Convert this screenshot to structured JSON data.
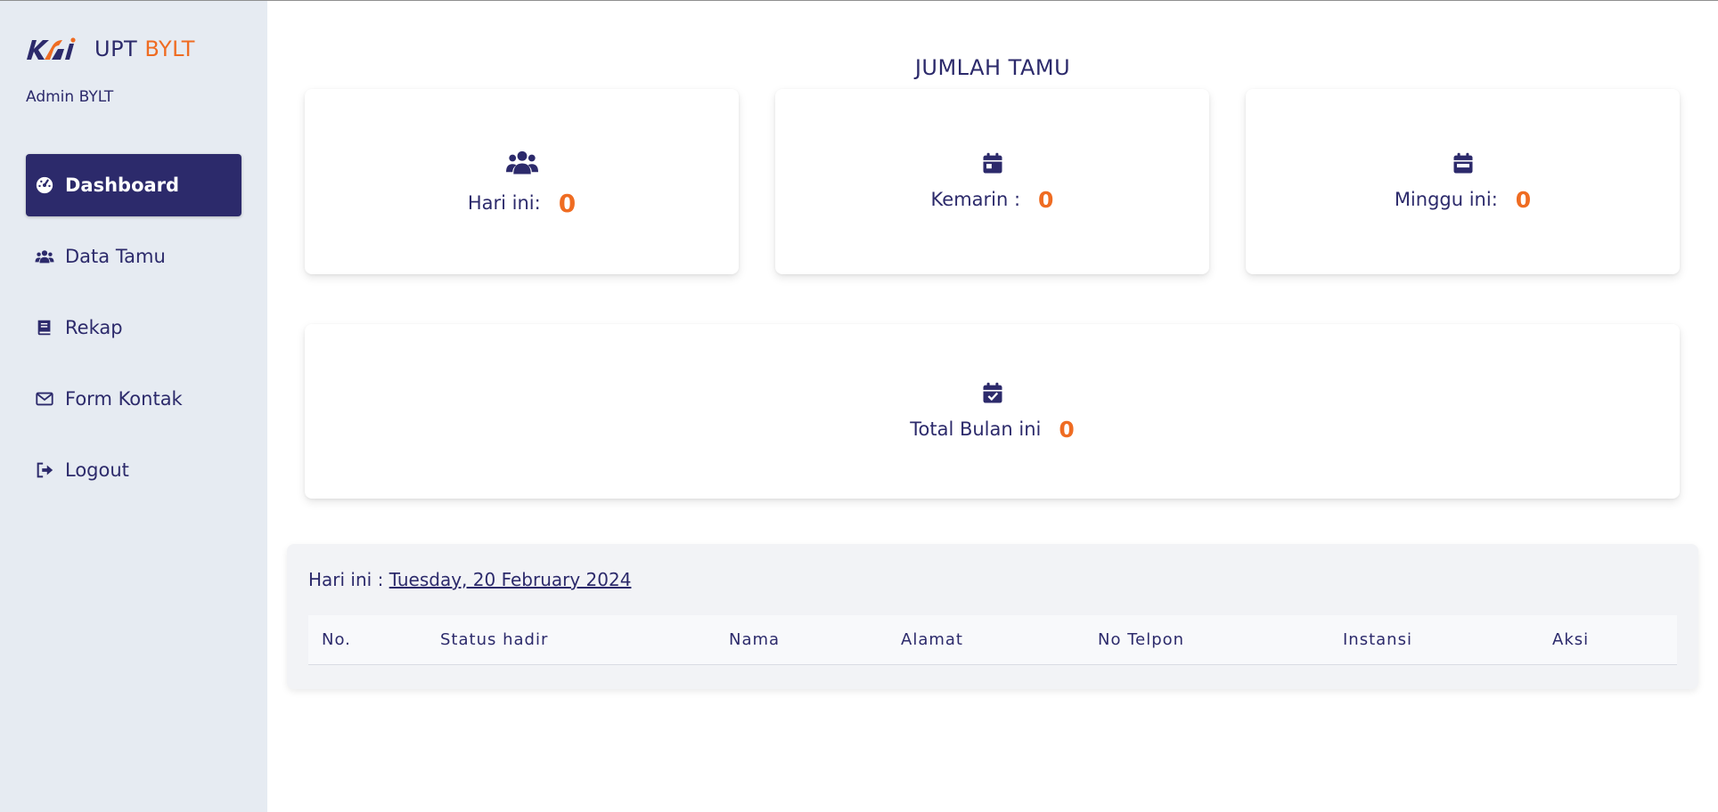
{
  "brand": {
    "logo": "kai-logo",
    "prefix": "UPT",
    "highlight": "BYLT"
  },
  "sidebar": {
    "user": "Admin BYLT",
    "items": [
      {
        "label": "Dashboard",
        "icon": "dashboard-gauge-icon",
        "active": true
      },
      {
        "label": "Data Tamu",
        "icon": "users-icon"
      },
      {
        "label": "Rekap",
        "icon": "book-icon"
      },
      {
        "label": "Form Kontak",
        "icon": "envelope-icon"
      },
      {
        "label": "Logout",
        "icon": "sign-out-icon"
      }
    ]
  },
  "main": {
    "title": "JUMLAH TAMU",
    "cards": [
      {
        "label": "Hari ini:",
        "value": "0",
        "icon": "users-icon"
      },
      {
        "label": "Kemarin :",
        "value": "0",
        "icon": "calendar-icon"
      },
      {
        "label": "Minggu ini:",
        "value": "0",
        "icon": "calendar-week-icon"
      },
      {
        "label": "Total Bulan ini",
        "value": "0",
        "icon": "calendar-check-icon"
      }
    ],
    "today": {
      "label": "Hari ini :",
      "date": "Tuesday, 20 February 2024"
    },
    "table": {
      "columns": [
        "No.",
        "Status hadir",
        "Nama",
        "Alamat",
        "No Telpon",
        "Instansi",
        "Aksi"
      ],
      "rows": []
    }
  },
  "colors": {
    "primary": "#2c2a6b",
    "accent": "#ef6c22",
    "sidebar_bg": "#e6ebf2"
  }
}
